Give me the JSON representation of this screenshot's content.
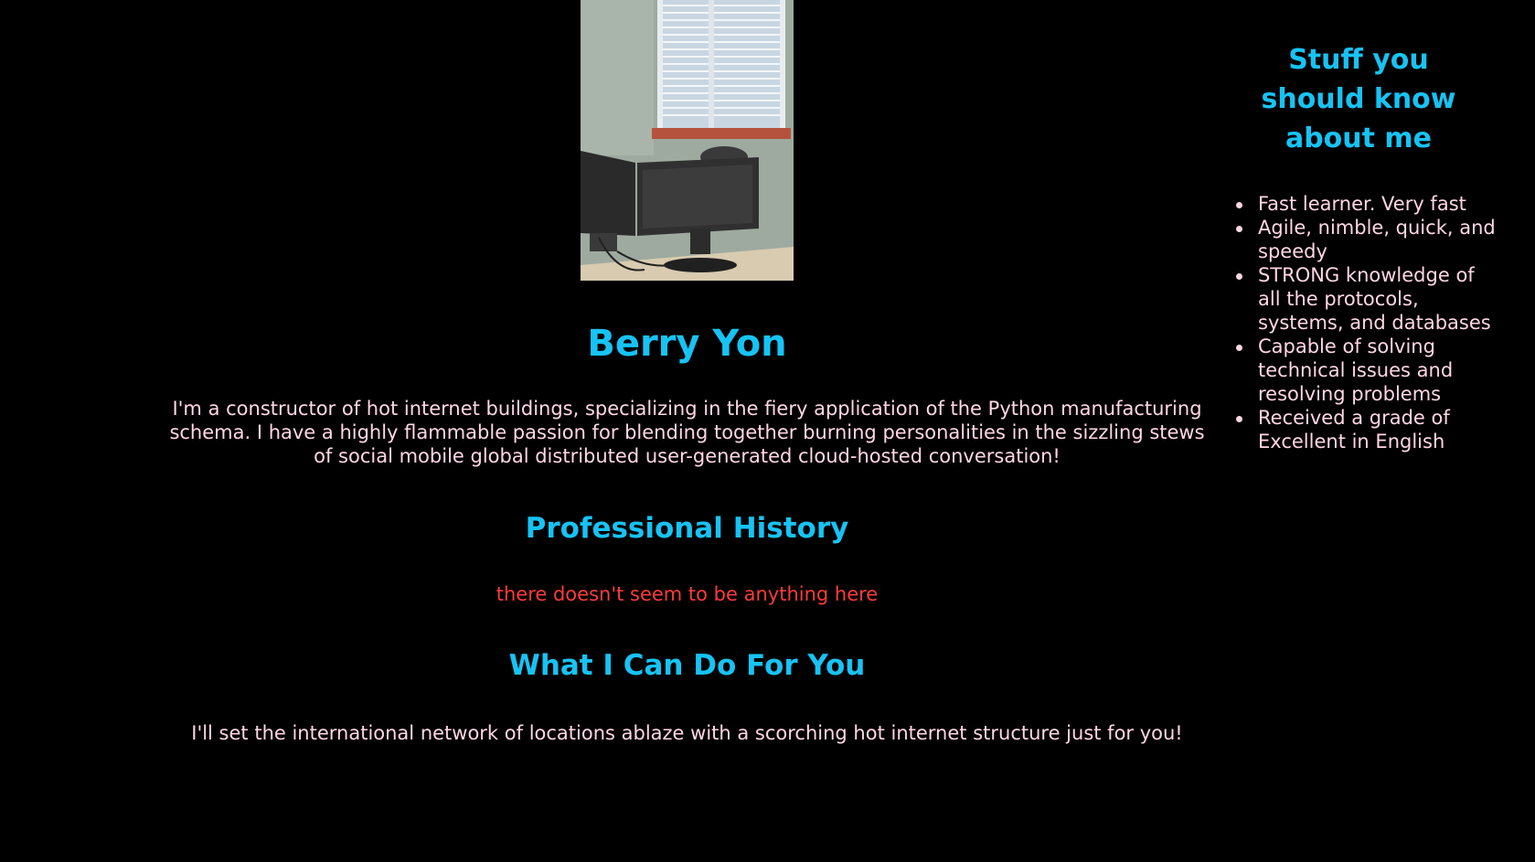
{
  "profile": {
    "name": "Berry Yon",
    "bio": "I'm a constructor of hot internet buildings, specializing in the fiery application of the Python manufacturing schema. I have a highly flammable passion for blending together burning personalities in the sizzling stews of social mobile global distributed user-generated cloud-hosted conversation!"
  },
  "history": {
    "heading": "Professional History",
    "empty_message": "there doesn't seem to be anything here"
  },
  "services": {
    "heading": "What I Can Do For You",
    "text": "I'll set the international network of locations ablaze with a scorching hot internet structure just for you!"
  },
  "sidebar": {
    "title": "Stuff you should know about me",
    "facts": [
      "Fast learner. Very fast",
      "Agile, nimble, quick, and speedy",
      "STRONG knowledge of all the protocols, systems, and databases",
      "Capable of solving technical issues and resolving problems",
      "Received a grade of Excellent in English"
    ]
  },
  "colors": {
    "background": "#000000",
    "heading": "#17c3f4",
    "body_text": "#ffd6e4",
    "empty_note": "#ff3b3b"
  },
  "icons": {
    "photo": "office-desk-with-monitors-photo"
  }
}
